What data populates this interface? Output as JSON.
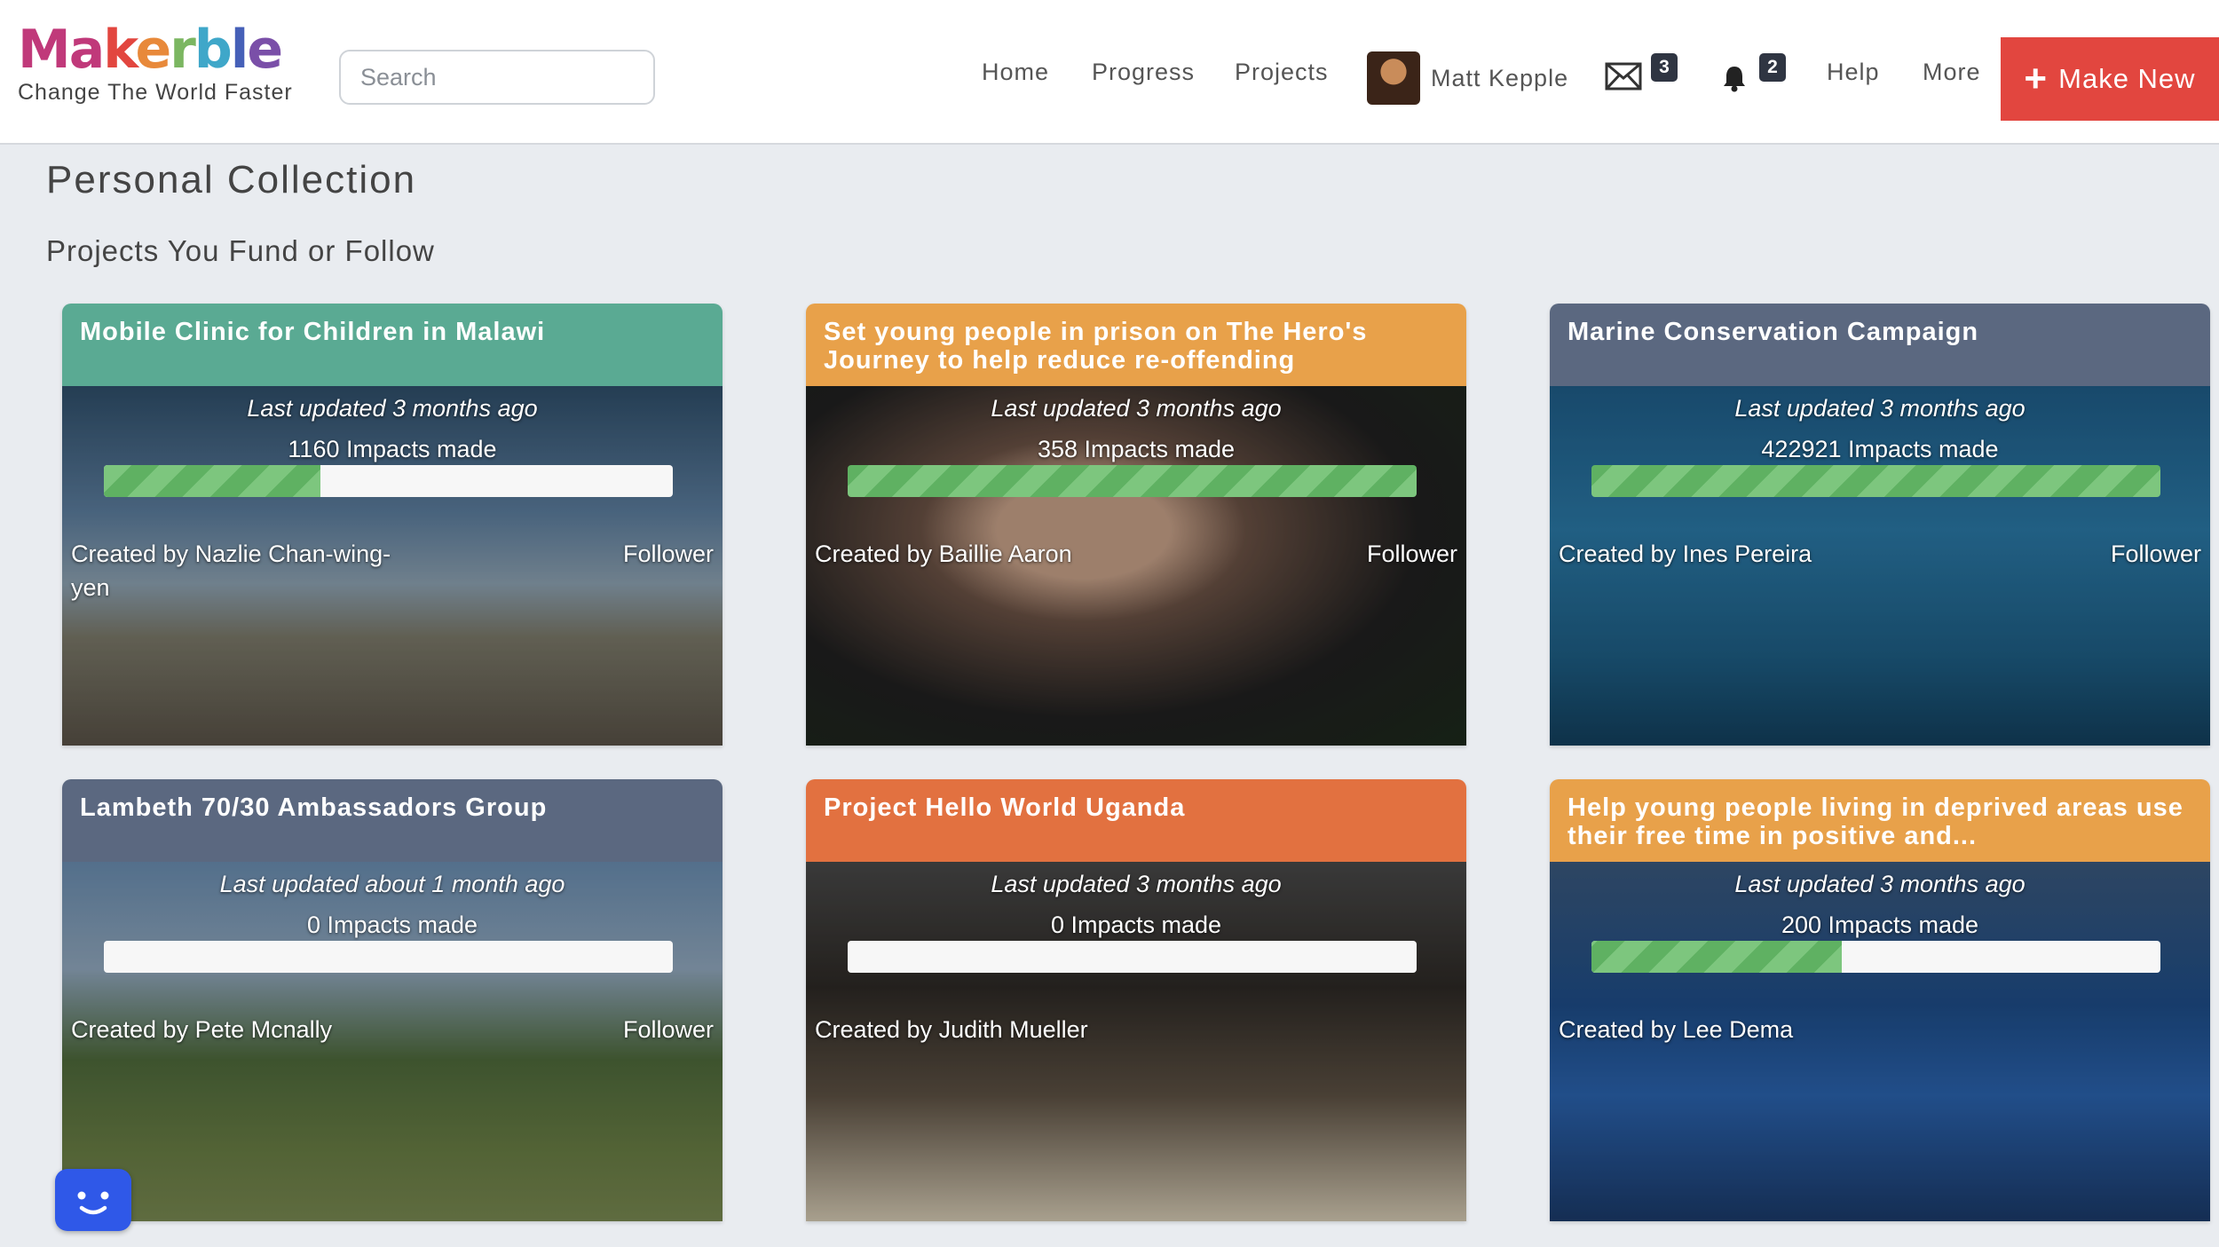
{
  "brand": {
    "letters": [
      {
        "ch": "M",
        "color": "#c0397a"
      },
      {
        "ch": "a",
        "color": "#c0397a"
      },
      {
        "ch": "k",
        "color": "#e2463f"
      },
      {
        "ch": "e",
        "color": "#e8893a"
      },
      {
        "ch": "r",
        "color": "#7bb661"
      },
      {
        "ch": "b",
        "color": "#3fa7c9"
      },
      {
        "ch": "l",
        "color": "#4660b8"
      },
      {
        "ch": "e",
        "color": "#7a4fa8"
      }
    ],
    "tagline": "Change The World Faster"
  },
  "search": {
    "placeholder": "Search"
  },
  "nav": {
    "home": "Home",
    "progress": "Progress",
    "projects": "Projects",
    "user_name": "Matt Kepple",
    "messages_count": "3",
    "notifications_count": "2",
    "help": "Help",
    "more": "More",
    "make_new": "Make New"
  },
  "page": {
    "title": "Personal Collection",
    "subtitle": "Projects You Fund or Follow"
  },
  "projects": [
    {
      "title": "Mobile Clinic for Children in Malawi",
      "updated": "Last updated 3 months ago",
      "impacts": "1160 Impacts made",
      "progress": 0.38,
      "creator": "Created by Nazlie Chan-wing-yen",
      "status": "Follower",
      "head_color": "#5aaa93"
    },
    {
      "title": "Set young people in prison on The Hero's Journey to help reduce re-offending",
      "updated": "Last updated 3 months ago",
      "impacts": "358 Impacts made",
      "progress": 1.0,
      "creator": "Created by Baillie Aaron",
      "status": "Follower",
      "head_color": "#e8a14a"
    },
    {
      "title": "Marine Conservation Campaign",
      "updated": "Last updated 3 months ago",
      "impacts": "422921 Impacts made",
      "progress": 1.0,
      "creator": "Created by Ines Pereira",
      "status": "Follower",
      "head_color": "#5b6880"
    },
    {
      "title": "Lambeth 70/30 Ambassadors Group",
      "updated": "Last updated about 1 month ago",
      "impacts": "0 Impacts made",
      "progress": 0.0,
      "creator": "Created by Pete Mcnally",
      "status": "Follower",
      "head_color": "#5b6880"
    },
    {
      "title": "Project Hello World Uganda",
      "updated": "Last updated 3 months ago",
      "impacts": "0 Impacts made",
      "progress": 0.0,
      "creator": "Created by Judith Mueller",
      "status": "",
      "head_color": "#e27140"
    },
    {
      "title": "Help young people living in deprived areas use their free time in positive and...",
      "updated": "Last updated 3 months ago",
      "impacts": "200 Impacts made",
      "progress": 0.44,
      "creator": "Created by Lee Dema",
      "status": "",
      "head_color": "#e8a14a"
    }
  ]
}
